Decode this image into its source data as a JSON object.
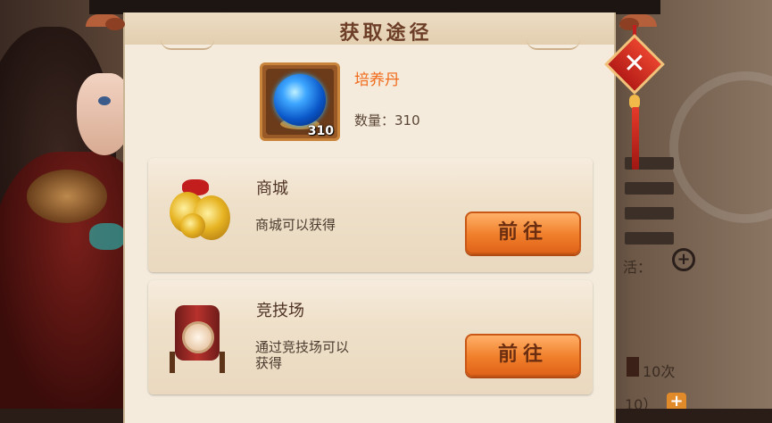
{
  "dialog": {
    "title": "获取途径",
    "close_icon": "close-x-icon"
  },
  "item": {
    "name": "培养丹",
    "icon": "blue-orb-icon",
    "badge_count": "310",
    "quantity_label": "数量：310"
  },
  "sources": [
    {
      "title": "商城",
      "icon": "gold-coins-icon",
      "description": "商城可以获得",
      "button_label": "前往"
    },
    {
      "title": "竞技场",
      "icon": "war-drum-icon",
      "description": "通过竞技场可以获得",
      "button_label": "前往"
    }
  ],
  "background_text": {
    "label": "活：",
    "times": "10次",
    "partial": "10）"
  },
  "colors": {
    "accent_orange": "#f07f2a",
    "item_name": "#f06a1a",
    "close_red": "#c21e1e"
  }
}
